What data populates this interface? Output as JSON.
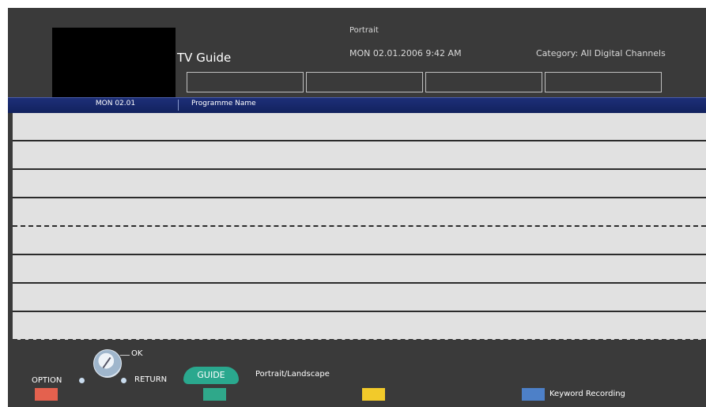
{
  "header": {
    "title": "TV Guide",
    "mode": "Portrait",
    "datetime": "MON 02.01.2006  9:42 AM",
    "category": "Category: All Digital Channels"
  },
  "columns": {
    "date": "MON 02.01",
    "programme": "Programme Name"
  },
  "footer": {
    "ok": "OK",
    "option": "OPTION",
    "return": "RETURN",
    "guide": "GUIDE",
    "orientation": "Portrait/Landscape",
    "keyword_recording": "Keyword Recording"
  },
  "colors": {
    "red": "#e4614e",
    "green": "#2fa88a",
    "yellow": "#f2ca2a",
    "blue": "#4d80c8"
  }
}
